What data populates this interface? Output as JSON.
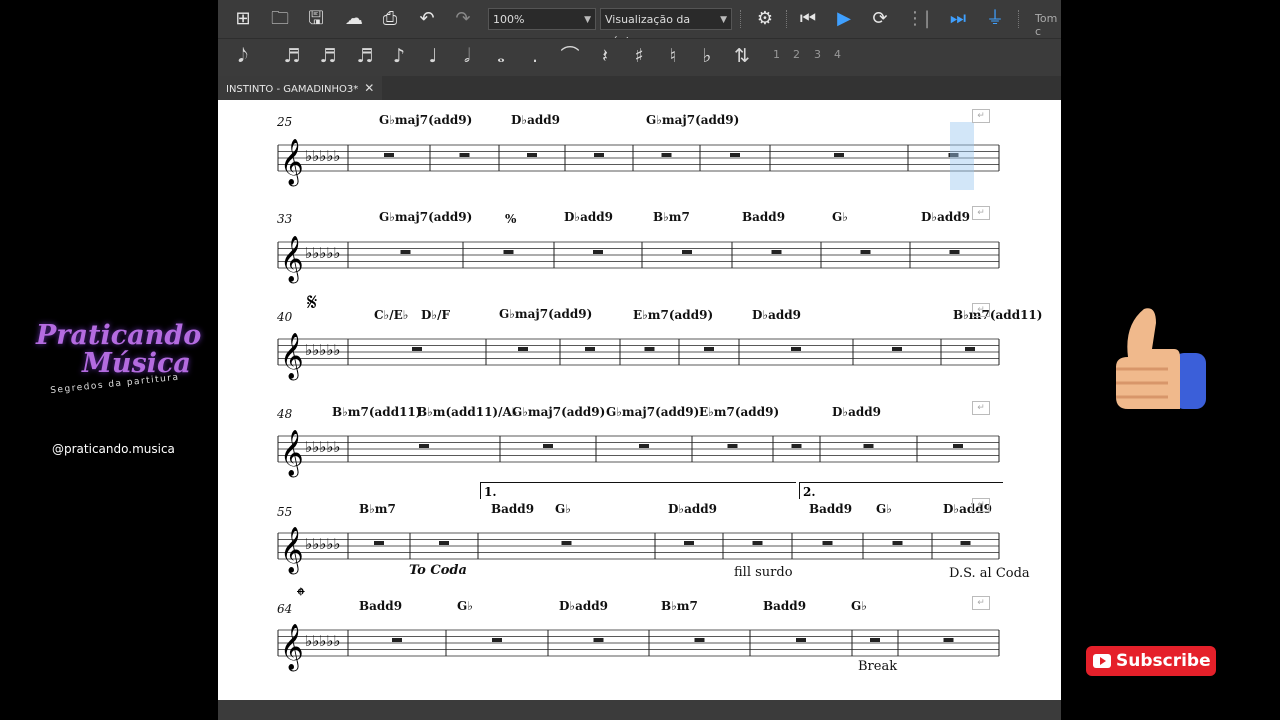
{
  "editor": {
    "zoom": "100%",
    "view_mode": "Visualização da página",
    "tone_label": "Tom c",
    "tab_title": "INSTINTO - GAMADINHO3*",
    "voices": [
      "1",
      "2",
      "3",
      "4"
    ]
  },
  "score": {
    "measure_numbers": [
      "25",
      "33",
      "40",
      "48",
      "55",
      "64"
    ],
    "chords": {
      "s1": [
        "G♭maj7(add9)",
        "D♭add9",
        "G♭maj7(add9)"
      ],
      "s2": [
        "G♭maj7(add9)",
        "%",
        "D♭add9",
        "B♭m7",
        "Badd9",
        "G♭",
        "D♭add9"
      ],
      "s3": [
        "C♭/E♭",
        "D♭/F",
        "G♭maj7(add9)",
        "E♭m7(add9)",
        "D♭add9",
        "B♭m7(add11)"
      ],
      "s4": [
        "B♭m7(add11)",
        "B♭m(add11)/A♭",
        "G♭maj7(add9)",
        "G♭maj7(add9)",
        "E♭m7(add9)",
        "D♭add9"
      ],
      "s5": [
        "B♭m7",
        "Badd9",
        "G♭",
        "D♭add9",
        "Badd9",
        "G♭",
        "D♭add9"
      ],
      "s6": [
        "Badd9",
        "G♭",
        "D♭add9",
        "B♭m7",
        "Badd9",
        "G♭"
      ]
    },
    "texts": {
      "to_coda": "To Coda",
      "fill": "fill surdo",
      "ds": "D.S. al Coda",
      "break": "Break",
      "volta1": "1.",
      "volta2": "2."
    }
  },
  "overlay": {
    "brand_line1": "Praticando",
    "brand_line2": "Música",
    "brand_tagline": "Segredos da partitura",
    "handle": "@praticando.musica",
    "subscribe": "Subscribe"
  }
}
